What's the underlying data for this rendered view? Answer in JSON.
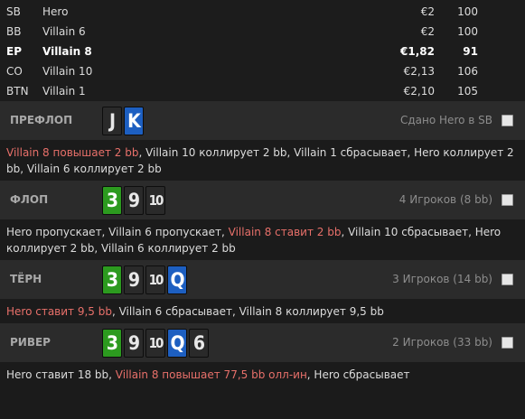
{
  "players": [
    {
      "pos": "SB",
      "name": "Hero",
      "stack": "€2",
      "bb": "100",
      "bold": false
    },
    {
      "pos": "BB",
      "name": "Villain 6",
      "stack": "€2",
      "bb": "100",
      "bold": false
    },
    {
      "pos": "EP",
      "name": "Villain 8",
      "stack": "€1,82",
      "bb": "91",
      "bold": true
    },
    {
      "pos": "CO",
      "name": "Villain 10",
      "stack": "€2,13",
      "bb": "106",
      "bold": false
    },
    {
      "pos": "BTN",
      "name": "Villain 1",
      "stack": "€2,10",
      "bb": "105",
      "bold": false
    }
  ],
  "streets": [
    {
      "label": "ПРЕФЛОП",
      "cards": [
        {
          "rank": "J",
          "color": "grey"
        },
        {
          "rank": "K",
          "color": "blue"
        }
      ],
      "info": "Сдано Hero в SB",
      "action": [
        {
          "text": "Villain 8 повышает 2 bb",
          "hl": true
        },
        {
          "text": ", Villain 10 коллирует 2 bb, Villain 1 сбрасывает, Hero коллирует 2 bb, Villain 6 коллирует 2 bb",
          "hl": false
        }
      ]
    },
    {
      "label": "ФЛОП",
      "cards": [
        {
          "rank": "3",
          "color": "green"
        },
        {
          "rank": "9",
          "color": "grey"
        },
        {
          "rank": "10",
          "color": "grey"
        }
      ],
      "info": "4 Игроков (8 bb)",
      "action": [
        {
          "text": "Hero пропускает, Villain 6 пропускает, ",
          "hl": false
        },
        {
          "text": "Villain 8 ставит 2 bb",
          "hl": true
        },
        {
          "text": ", Villain 10 сбрасывает, Hero коллирует 2 bb, Villain 6 коллирует 2 bb",
          "hl": false
        }
      ]
    },
    {
      "label": "ТЁРН",
      "cards": [
        {
          "rank": "3",
          "color": "green"
        },
        {
          "rank": "9",
          "color": "grey"
        },
        {
          "rank": "10",
          "color": "grey"
        },
        {
          "rank": "Q",
          "color": "blue"
        }
      ],
      "info": "3 Игроков (14 bb)",
      "action": [
        {
          "text": "Hero ставит 9,5 bb",
          "hl": true
        },
        {
          "text": ", Villain 6 сбрасывает, Villain 8 коллирует 9,5 bb",
          "hl": false
        }
      ]
    },
    {
      "label": "РИВЕР",
      "cards": [
        {
          "rank": "3",
          "color": "green"
        },
        {
          "rank": "9",
          "color": "grey"
        },
        {
          "rank": "10",
          "color": "grey"
        },
        {
          "rank": "Q",
          "color": "blue"
        },
        {
          "rank": "6",
          "color": "grey"
        }
      ],
      "info": "2 Игроков (33 bb)",
      "action": [
        {
          "text": "Hero ставит 18 bb, ",
          "hl": false
        },
        {
          "text": "Villain 8 повышает 77,5 bb олл-ин",
          "hl": true
        },
        {
          "text": ", Hero сбрасывает",
          "hl": false
        }
      ]
    }
  ],
  "colors": {
    "highlight": "#e8706a",
    "card_blue": "#1d5fc1",
    "card_green": "#2c9a1f",
    "card_grey": "#2a2a2a"
  }
}
